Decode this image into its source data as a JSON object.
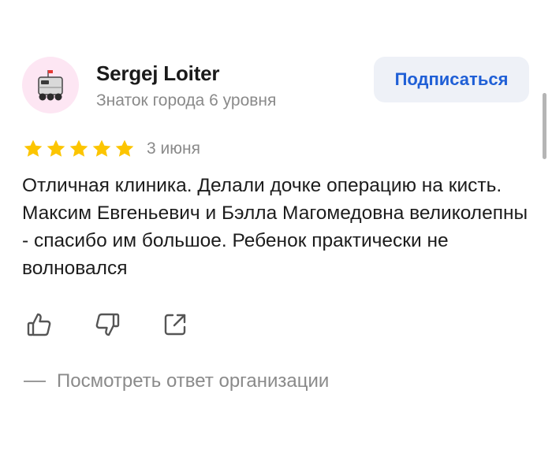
{
  "author": {
    "name": "Sergej Loiter",
    "level": "Знаток города 6 уровня",
    "avatar_icon": "delivery-robot-icon"
  },
  "subscribe": {
    "label": "Подписаться"
  },
  "review": {
    "rating": 5,
    "rating_max": 5,
    "date": "3 июня",
    "text": "Отличная клиника. Делали дочке операцию на кисть. Максим Евгеньевич и Бэлла Магомедовна великолепны - спасибо им большое. Ребенок практически не волновался"
  },
  "actions": {
    "like_icon": "thumbs-up-icon",
    "dislike_icon": "thumbs-down-icon",
    "share_icon": "share-icon"
  },
  "org_reply": {
    "label": "Посмотреть ответ организации"
  },
  "colors": {
    "accent": "#1f5fd6",
    "star": "#fcc500",
    "muted": "#8a8a8a",
    "button_bg": "#eef1f7",
    "avatar_bg": "#fde6f3"
  }
}
